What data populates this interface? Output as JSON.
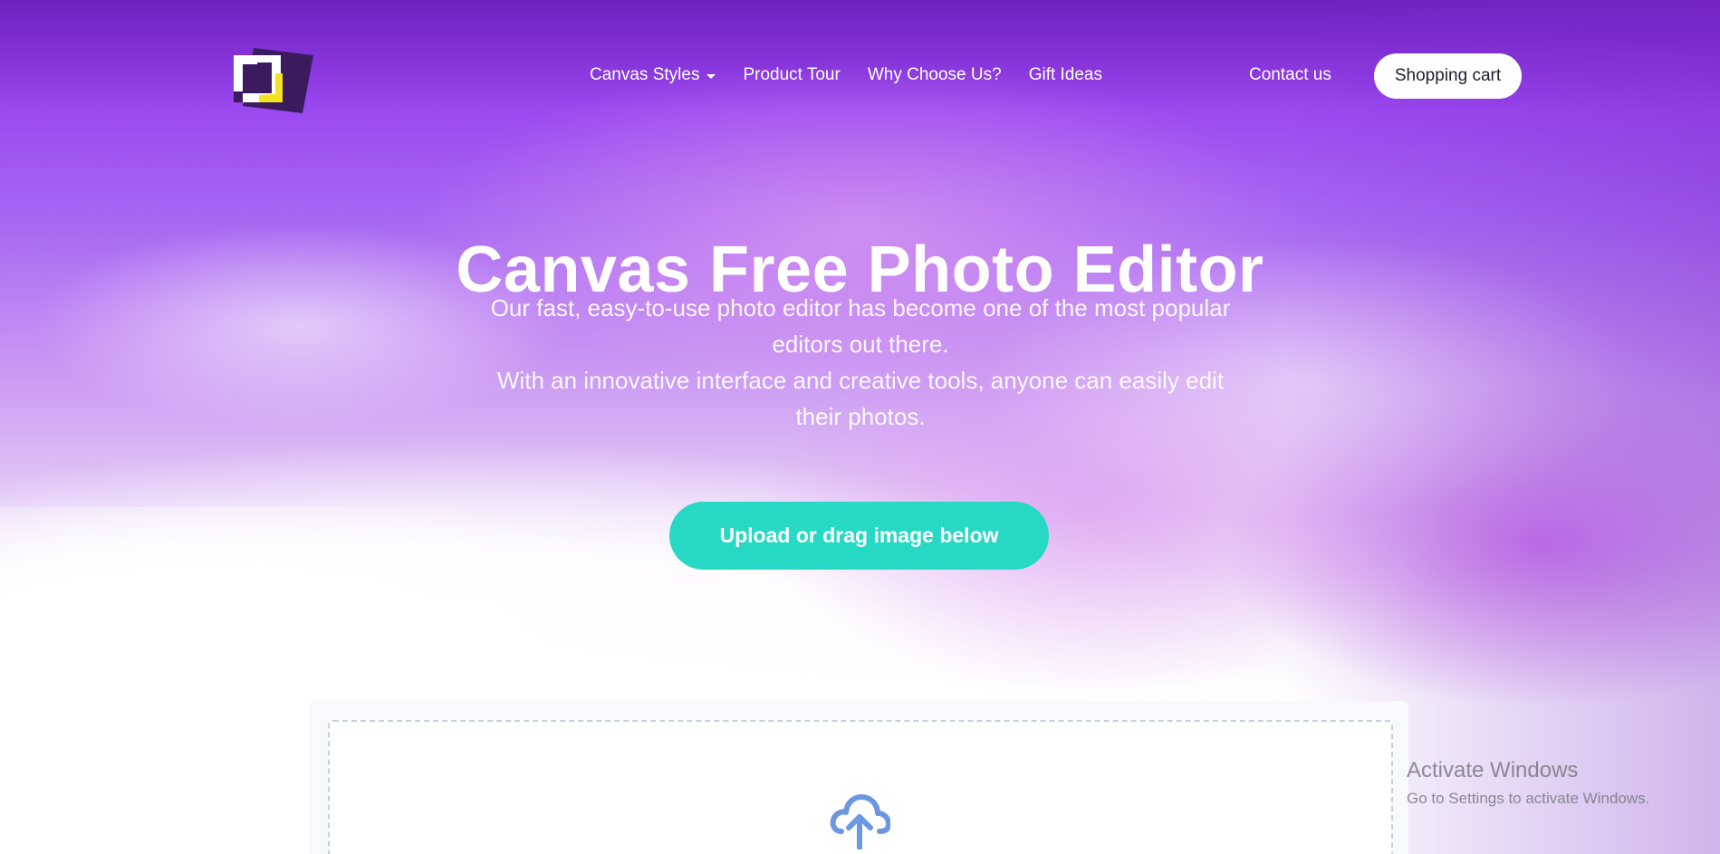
{
  "header": {
    "logo_name": "canvas-logo",
    "nav": [
      {
        "label": "Canvas Styles",
        "has_dropdown": true
      },
      {
        "label": "Product Tour",
        "has_dropdown": false
      },
      {
        "label": "Why Choose Us?",
        "has_dropdown": false
      },
      {
        "label": "Gift Ideas",
        "has_dropdown": false
      }
    ],
    "contact_label": "Contact us",
    "cart_label": "Shopping cart"
  },
  "hero": {
    "title": "Canvas Free Photo Editor",
    "paragraph_1": "Our fast, easy-to-use photo editor has become one of the most popular editors out there.",
    "paragraph_2": "With an innovative interface and creative tools, anyone can easily edit their photos.",
    "cta_label": "Upload or drag image below"
  },
  "upload": {
    "icon": "cloud-upload-icon"
  },
  "watermark": {
    "title": "Activate Windows",
    "subtitle": "Go to Settings to activate Windows."
  },
  "colors": {
    "accent": "#27d9c4",
    "background_purple": "#8a33e6",
    "upload_icon": "#6b96e0",
    "logo_yellow": "#f3e423",
    "logo_dark": "#3b1b5e"
  }
}
